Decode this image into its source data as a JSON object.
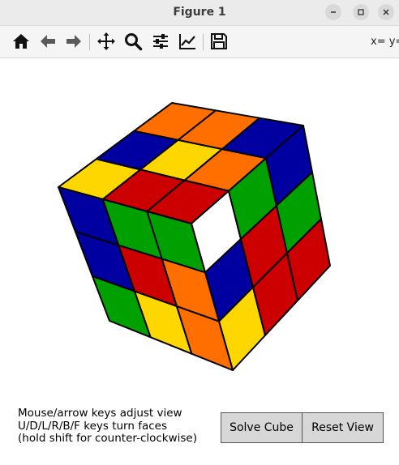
{
  "window": {
    "title": "Figure 1"
  },
  "window_controls": [
    "minimize-icon",
    "maximize-icon",
    "close-icon"
  ],
  "toolbar": {
    "tools": [
      {
        "name": "home-icon"
      },
      {
        "name": "back-arrow-icon"
      },
      {
        "name": "forward-arrow-icon"
      },
      {
        "name": "pan-icon"
      },
      {
        "name": "zoom-icon"
      },
      {
        "name": "subplots-config-icon"
      },
      {
        "name": "edit-axis-icon"
      },
      {
        "name": "save-icon"
      }
    ],
    "coords": "x= y="
  },
  "cube": {
    "colors": {
      "yellow": "#ffd700",
      "red": "#cc0000",
      "orange": "#ff6f00",
      "blue": "#0000a0",
      "green": "#00a000",
      "white": "#ffffff"
    },
    "top_face": [
      [
        "orange",
        "orange",
        "blue"
      ],
      [
        "blue",
        "yellow",
        "orange"
      ],
      [
        "yellow",
        "red",
        "red"
      ]
    ],
    "right_face": [
      [
        "white",
        "green",
        "blue"
      ],
      [
        "blue",
        "red",
        "green"
      ],
      [
        "yellow",
        "red",
        "red"
      ]
    ],
    "left_face": [
      [
        "blue",
        "green",
        "green"
      ],
      [
        "blue",
        "red",
        "orange"
      ],
      [
        "green",
        "yellow",
        "orange"
      ]
    ]
  },
  "help_text": {
    "line1": "Mouse/arrow keys adjust view",
    "line2": "U/D/L/R/B/F keys turn faces",
    "line3": "(hold shift for counter-clockwise)"
  },
  "buttons": {
    "solve": "Solve Cube",
    "reset": "Reset View"
  }
}
